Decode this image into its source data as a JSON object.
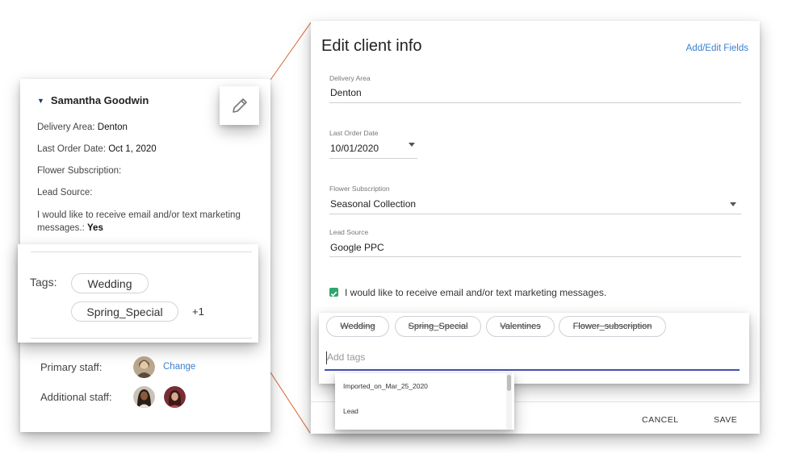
{
  "client": {
    "name": "Samantha Goodwin",
    "delivery_area_label": "Delivery Area:",
    "delivery_area_value": "Denton",
    "last_order_label": "Last Order Date:",
    "last_order_value": "Oct 1, 2020",
    "subscription_label": "Flower Subscription:",
    "lead_source_label": "Lead Source:",
    "marketing_text": "I would like to receive email and/or text marketing messages.:",
    "marketing_value": "Yes"
  },
  "tags_section": {
    "label": "Tags:",
    "tags": [
      "Wedding",
      "Spring_Special"
    ],
    "more": "+1"
  },
  "staff": {
    "primary_label": "Primary staff:",
    "change_link": "Change",
    "additional_label": "Additional staff:"
  },
  "dialog": {
    "title": "Edit client info",
    "add_edit_fields": "Add/Edit Fields",
    "delivery_area_label": "Delivery Area",
    "delivery_area_value": "Denton",
    "last_order_label": "Last Order Date",
    "last_order_value": "10/01/2020",
    "subscription_label": "Flower Subscription",
    "subscription_value": "Seasonal Collection",
    "lead_source_label": "Lead Source",
    "lead_source_value": "Google PPC",
    "marketing_checkbox_text": "I would like to receive email and/or text marketing messages.",
    "marketing_checked": true,
    "cancel": "CANCEL",
    "save": "SAVE"
  },
  "tag_editor": {
    "tags": [
      "Wedding",
      "Spring_Special",
      "Valentines",
      "Flower_subscription"
    ],
    "placeholder": "Add tags",
    "suggestions": [
      "Imported_on_Mar_25_2020",
      "Lead"
    ]
  },
  "colors": {
    "accent_blue": "#3b7fd1",
    "input_underline": "#3f51b5",
    "checkbox_green": "#2ea66d",
    "connector_orange": "#d8672c"
  },
  "icons": {
    "edit": "pencil-icon",
    "collapse": "caret-down-icon",
    "dropdown": "triangle-down-icon",
    "checkbox": "check-icon"
  }
}
